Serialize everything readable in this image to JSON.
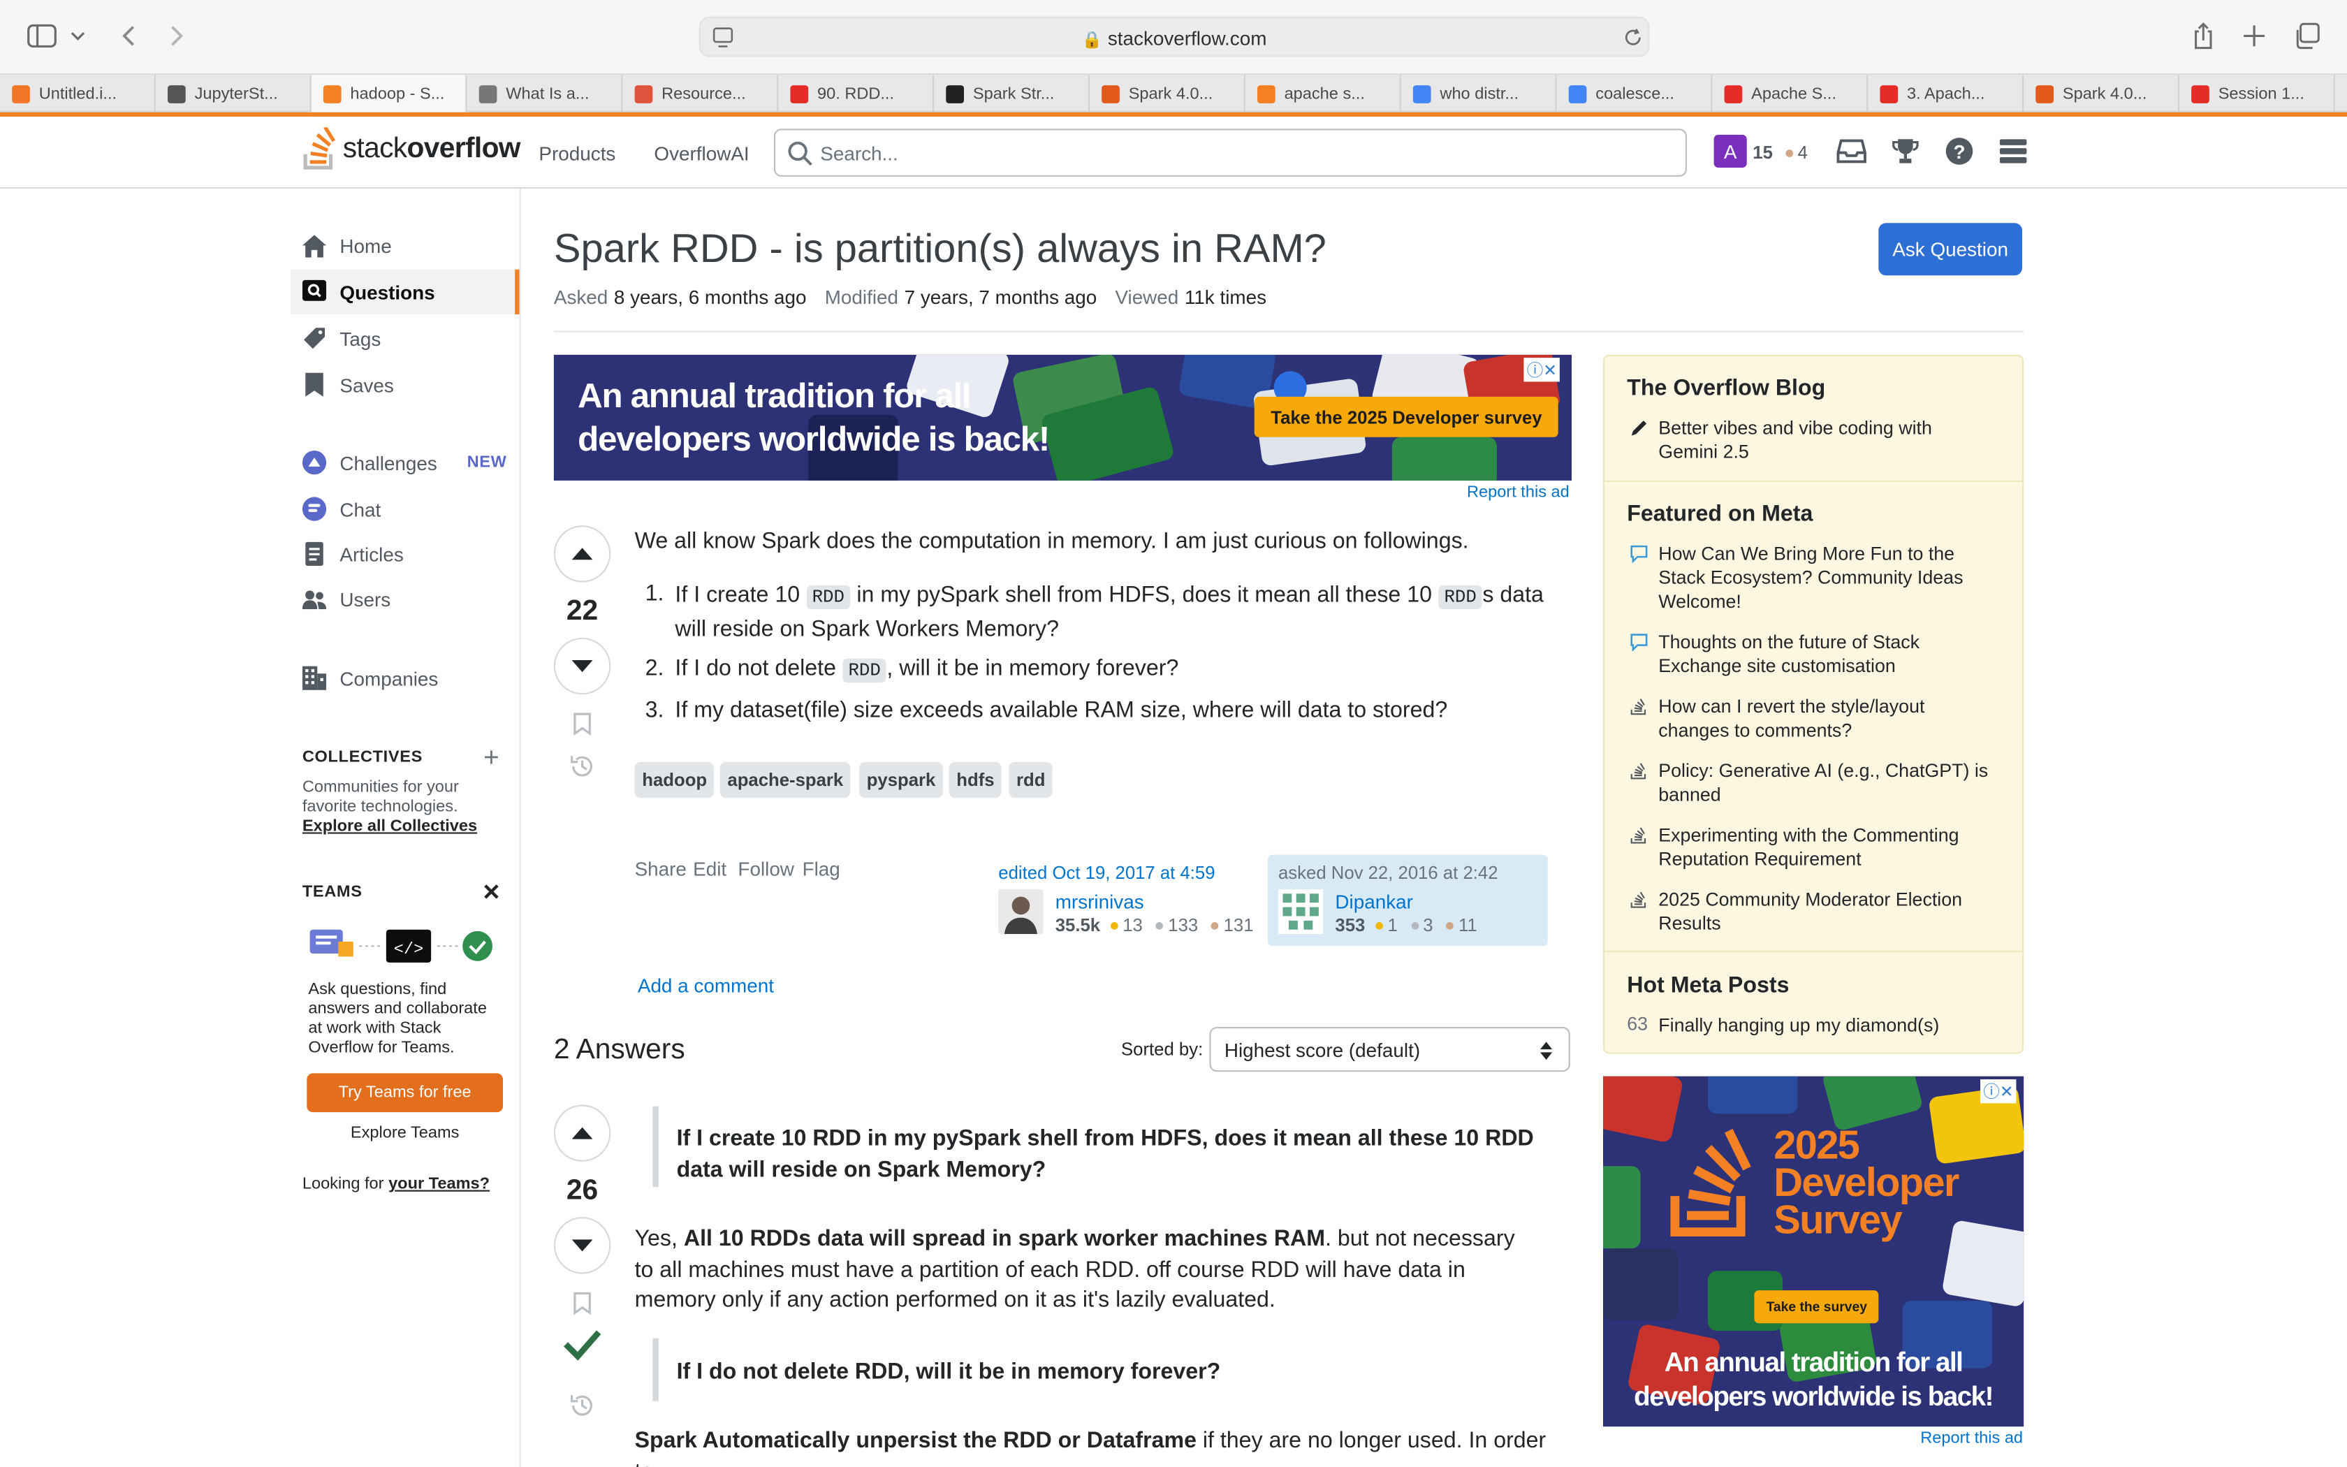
{
  "browser": {
    "url": "stackoverflow.com",
    "tabs": [
      {
        "label": "Untitled.i...",
        "color": "#f37626"
      },
      {
        "label": "JupyterSt...",
        "color": "#555555"
      },
      {
        "label": "hadoop - S...",
        "color": "#f48024",
        "active": true
      },
      {
        "label": "What Is a...",
        "color": "#777777"
      },
      {
        "label": "Resource...",
        "color": "#e0533c"
      },
      {
        "label": "90. RDD...",
        "color": "#e52d27"
      },
      {
        "label": "Spark Str...",
        "color": "#222222"
      },
      {
        "label": "Spark 4.0...",
        "color": "#e25a1c"
      },
      {
        "label": "apache s...",
        "color": "#f48024"
      },
      {
        "label": "who distr...",
        "color": "#4285f4"
      },
      {
        "label": "coalesce...",
        "color": "#4285f4"
      },
      {
        "label": "Apache S...",
        "color": "#e52d27"
      },
      {
        "label": "3. Apach...",
        "color": "#e52d27"
      },
      {
        "label": "Spark 4.0...",
        "color": "#e25a1c"
      },
      {
        "label": "Session 1...",
        "color": "#e52d27"
      }
    ]
  },
  "header": {
    "logo_prefix": "stack",
    "logo_suffix": "overflow",
    "products": "Products",
    "overflowai": "OverflowAI",
    "search_placeholder": "Search...",
    "avatar_letter": "A",
    "rep": "15",
    "bronze": "4"
  },
  "leftnav": {
    "home": "Home",
    "questions": "Questions",
    "tags": "Tags",
    "saves": "Saves",
    "challenges": "Challenges",
    "new_badge": "NEW",
    "chat": "Chat",
    "articles": "Articles",
    "users": "Users",
    "companies": "Companies",
    "collectives_title": "COLLECTIVES",
    "collectives_desc": "Communities for your favorite technologies.",
    "collectives_link": "Explore all Collectives",
    "teams_title": "TEAMS",
    "teams_desc": "Ask questions, find answers and collaborate at work with Stack Overflow for Teams.",
    "teams_btn": "Try Teams for free",
    "teams_explore": "Explore Teams",
    "looking_for": "Looking for",
    "your_teams": "your Teams?"
  },
  "question": {
    "title": "Spark RDD - is partition(s) always in RAM?",
    "asked_label": "Asked",
    "asked": "8 years, 6 months ago",
    "modified_label": "Modified",
    "modified": "7 years, 7 months ago",
    "viewed_label": "Viewed",
    "viewed": "11k times",
    "ask_button": "Ask Question",
    "votes": "22",
    "intro": "We all know Spark does the computation in memory. I am just curious on followings.",
    "items": [
      {
        "num": "1.",
        "a": "If I create 10 ",
        "code": "RDD",
        "b": " in my pySpark shell from HDFS, does it mean all these 10 ",
        "code2": "RDD",
        "c": "s data will reside on Spark Workers Memory?"
      },
      {
        "num": "2.",
        "a": "If I do not delete ",
        "code": "RDD",
        "b": ", will it be in memory forever?"
      },
      {
        "num": "3.",
        "a": "If my dataset(file) size exceeds available RAM size, where will data to stored?"
      }
    ],
    "tags": [
      "hadoop",
      "apache-spark",
      "pyspark",
      "hdfs",
      "rdd"
    ],
    "actions": [
      "Share",
      "Edit",
      "Follow",
      "Flag"
    ],
    "edited": "edited Oct 19, 2017 at 4:59",
    "editor": "mrsrinivas",
    "editor_rep": "35.5k",
    "editor_gold": "13",
    "editor_silver": "133",
    "editor_bronze": "131",
    "asked_on": "asked Nov 22, 2016 at 2:42",
    "asker": "Dipankar",
    "asker_rep": "353",
    "asker_gold": "1",
    "asker_silver": "3",
    "asker_bronze": "11",
    "add_comment": "Add a comment"
  },
  "ad_top": {
    "line1": "An annual tradition for all",
    "line2": "developers worldwide is back!",
    "cta": "Take the 2025 Developer survey",
    "report": "Report this ad"
  },
  "answers": {
    "heading": "2 Answers",
    "sorted_label": "Sorted by:",
    "sorted_value": "Highest score (default)",
    "first": {
      "votes": "26",
      "quote1": "If I create 10 RDD in my pySpark shell from HDFS, does it mean all these 10 RDD data will reside on Spark Memory?",
      "p1_pre": "Yes, ",
      "p1_bold": "All 10 RDDs data will spread in spark worker machines RAM",
      "p1_post": ". but not necessary to all machines must have a partition of each RDD. off course RDD will have data in memory only if any action performed on it as it's lazily evaluated.",
      "quote2": "If I do not delete RDD, will it be in memory forever?",
      "p2_bold": "Spark Automatically unpersist the RDD or Dataframe",
      "p2_post": " if they are no longer used. In order to"
    }
  },
  "sidebar": {
    "blog_title": "The Overflow Blog",
    "blog_items": [
      "Better vibes and vibe coding with Gemini 2.5"
    ],
    "meta_title": "Featured on Meta",
    "meta_items": [
      "How Can We Bring More Fun to the Stack Ecosystem? Community Ideas Welcome!",
      "Thoughts on the future of Stack Exchange site customisation",
      "How can I revert the style/layout changes to comments?",
      "Policy: Generative AI (e.g., ChatGPT) is banned",
      "Experimenting with the Commenting Reputation Requirement",
      "2025 Community Moderator Election Results"
    ],
    "hot_title": "Hot Meta Posts",
    "hot_count": "63",
    "hot_item": "Finally hanging up my diamond(s)"
  },
  "ad_side": {
    "year": "2025",
    "line1": "Developer",
    "line2": "Survey",
    "cta": "Take the survey",
    "tag1": "An annual tradition for all",
    "tag2": "developers worldwide is back!",
    "report": "Report this ad"
  },
  "colors": {
    "accent": "#f48225",
    "link": "#0074cc",
    "accepted": "#2f6f44",
    "primary_btn": "#2e6fd5"
  }
}
